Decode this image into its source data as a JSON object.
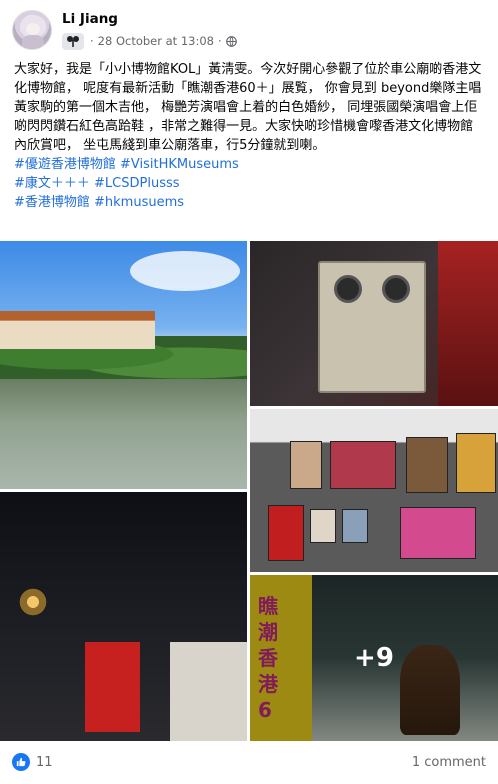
{
  "post": {
    "author": "Li Jiang",
    "timestamp": "28 October at 13:08",
    "separator": "·",
    "audience_icon": "globe-icon",
    "badge_icon": "group-badge-icon",
    "text": "大家好，我是「小小博物館KOL」黃淸雯。今次好開心參觀了位於車公廟啲香港文化博物館， 呢度有最新活動「瞧潮香港60＋」展覧， 你會見到 beyond樂隊主唱黃家駒的第一個木吉他， 梅艷芳演唱會上着的白色婚紗， 同埋張國榮演唱會上佢啲閃閃鑽石紅色高跲鞋 ，非常之難得一見。大家快啲珍惜機會嚟香港文化博物館內欣賞吧， 坐屯馬綫到車公廟落車，行5分鐘就到喇。",
    "hashtags": [
      "#優遊香港博物館 #VisitHKMuseums",
      "#康文＋＋＋ #LCSDPlusss",
      "#香港博物館 #hkmusuems"
    ]
  },
  "photos": {
    "more_count": "+9",
    "poster_text": "瞧\n潮\n香\n港\n6"
  },
  "footer": {
    "like_count": "11",
    "comments": "1 comment"
  },
  "colors": {
    "link": "#216fdb",
    "like_blue": "#1877f2",
    "meta_grey": "#65676b"
  }
}
